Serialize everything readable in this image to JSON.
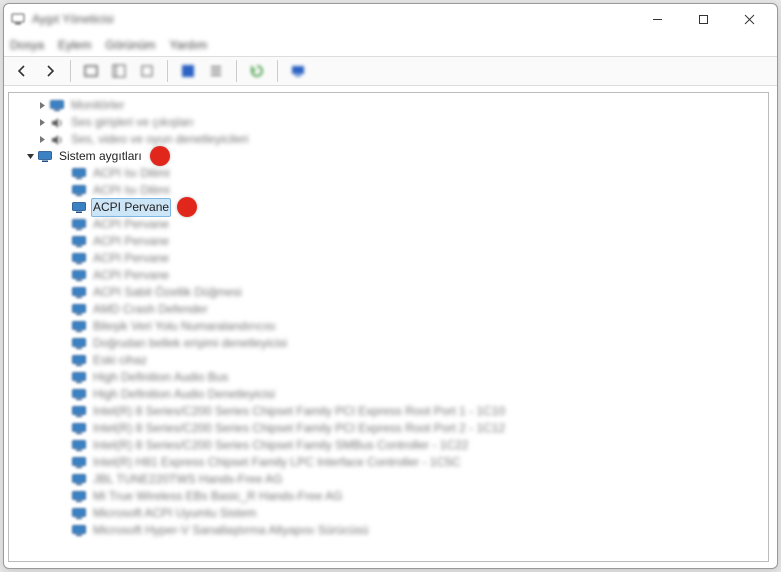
{
  "window": {
    "title": "Aygıt Yöneticisi",
    "menu": [
      "Dosya",
      "Eylem",
      "Görünüm",
      "Yardım"
    ]
  },
  "toolbar": {
    "back": "back-icon",
    "forward": "forward-icon",
    "b1": "rect-icon",
    "b2": "tree-icon",
    "b3": "square-icon",
    "b4": "help-icon",
    "b5": "list-icon",
    "b6": "refresh-icon",
    "b7": "monitor-icon"
  },
  "tree": {
    "preBlur": [
      {
        "indent": 40,
        "icon": "monitor",
        "text": "Monitörler",
        "twisty": "right"
      },
      {
        "indent": 40,
        "icon": "audio",
        "text": "Ses girişleri ve çıkışları",
        "twisty": "right"
      },
      {
        "indent": 40,
        "icon": "audio",
        "text": "Ses, video ve oyun denetleyicileri",
        "twisty": "right"
      }
    ],
    "categoryRow": {
      "indent": 28,
      "icon": "monitor",
      "label": "Sistem aygıtları",
      "twisty": "down"
    },
    "childrenBlurBefore": [
      {
        "text": "ACPI Isı Dilimi"
      },
      {
        "text": "ACPI Isı Dilimi"
      }
    ],
    "selectedRow": {
      "indent": 62,
      "icon": "monitor",
      "label": "ACPI Pervane"
    },
    "childrenBlurAfter": [
      {
        "text": "ACPI Pervane"
      },
      {
        "text": "ACPI Pervane"
      },
      {
        "text": "ACPI Pervane"
      },
      {
        "text": "ACPI Pervane"
      },
      {
        "text": "ACPI Sabit Özellik Düğmesi"
      },
      {
        "text": "AMD Crash Defender"
      },
      {
        "text": "Bileşik Veri Yolu Numaralandırıcısı"
      },
      {
        "text": "Doğrudan bellek erişimi denetleyicisi"
      },
      {
        "text": "Eski cihaz"
      },
      {
        "text": "High Definition Audio Bus"
      },
      {
        "text": "High Definition Audio Denetleyicisi"
      },
      {
        "text": "Intel(R) 8 Series/C200 Series Chipset Family PCI Express Root Port 1 - 1C10"
      },
      {
        "text": "Intel(R) 8 Series/C200 Series Chipset Family PCI Express Root Port 2 - 1C12"
      },
      {
        "text": "Intel(R) 8 Series/C200 Series Chipset Family SMBus Controller - 1C22"
      },
      {
        "text": "Intel(R) H81 Express Chipset Family LPC Interface Controller - 1C5C"
      },
      {
        "text": "JBL TUNE220TWS Hands-Free AG"
      },
      {
        "text": "Mi True Wireless EBs Basic_R Hands-Free AG"
      },
      {
        "text": "Microsoft ACPI Uyumlu Sistem"
      },
      {
        "text": "Microsoft Hyper-V Sanallaştırma Altyapısı Sürücüsü"
      }
    ]
  },
  "callouts": {
    "c1": {
      "top": "category"
    },
    "c2": {
      "top": "selected"
    }
  }
}
